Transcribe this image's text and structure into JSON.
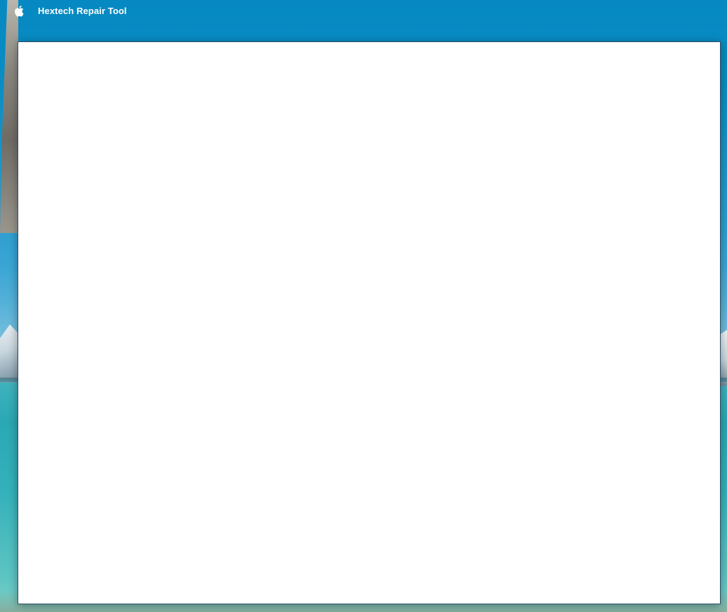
{
  "menu_bar": {
    "apple_icon": "apple-logo-icon",
    "app_name": "Hextech Repair Tool"
  },
  "window": {
    "content": ""
  },
  "colors": {
    "menu_text": "#ffffff",
    "sky_top": "#0689c2",
    "water": "#2aa8b4",
    "window_background": "#ffffff"
  }
}
